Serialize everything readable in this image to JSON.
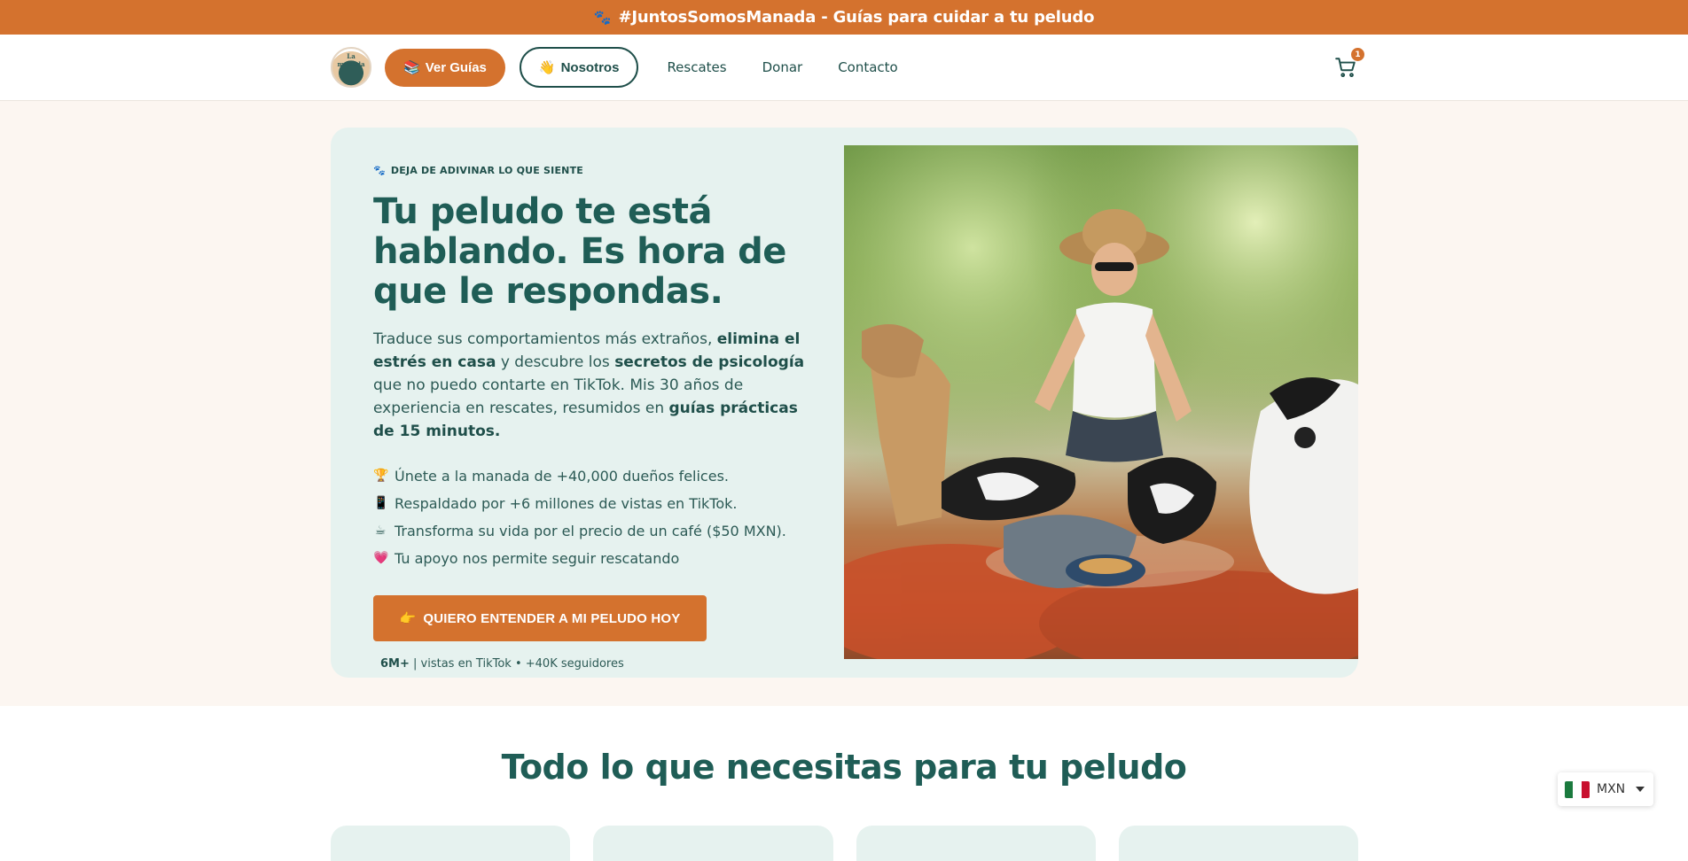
{
  "announcement": {
    "icon": "paw-icon",
    "text": "#JuntosSomosManada - Guías para cuidar a tu peludo"
  },
  "header": {
    "logo_text": "La manada",
    "guides_button": {
      "icon": "books-icon",
      "label": "Ver Guías"
    },
    "about_button": {
      "icon": "waving-hand-icon",
      "label": "Nosotros"
    },
    "nav": [
      "Rescates",
      "Donar",
      "Contacto"
    ],
    "cart_count": "1"
  },
  "hero": {
    "eyebrow": "DEJA DE ADIVINAR LO QUE SIENTE",
    "headline": "Tu peludo te está hablando. Es hora de que le respondas.",
    "desc": {
      "p1": "Traduce sus comportamientos más extraños, ",
      "b1": "elimina el estrés en casa",
      "p2": " y descubre los ",
      "b2": "secretos de psicología",
      "p3": " que no puedo contarte en TikTok. Mis 30 años de experiencia en rescates, resumidos en ",
      "b3": "guías prácticas de 15 minutos."
    },
    "features": [
      {
        "icon": "trophy-icon",
        "glyph": "🏆",
        "text": "Únete a la manada de +40,000 dueños felices."
      },
      {
        "icon": "phone-icon",
        "glyph": "📱",
        "text": "Respaldado por +6 millones de vistas en TikTok."
      },
      {
        "icon": "coffee-icon",
        "glyph": "☕",
        "text": "Transforma su vida por el precio de un café ($50 MXN)."
      },
      {
        "icon": "heart-icon",
        "glyph": "💗",
        "text": "Tu apoyo nos permite seguir rescatando"
      }
    ],
    "cta": {
      "icon": "pointing-hand-icon",
      "label": "QUIERO ENTENDER A MI PELUDO HOY"
    },
    "social_proof": {
      "strong": "6M+",
      "rest": " | vistas en TikTok • +40K seguidores"
    }
  },
  "section_title": "Todo lo que necesitas para tu peludo",
  "currency": {
    "code": "MXN",
    "flag": "mexico-flag-icon"
  },
  "colors": {
    "brand_orange": "#d4722e",
    "brand_teal": "#1f5d56",
    "card_bg": "#e6f2ef",
    "hero_bg": "#fcf6f1"
  }
}
